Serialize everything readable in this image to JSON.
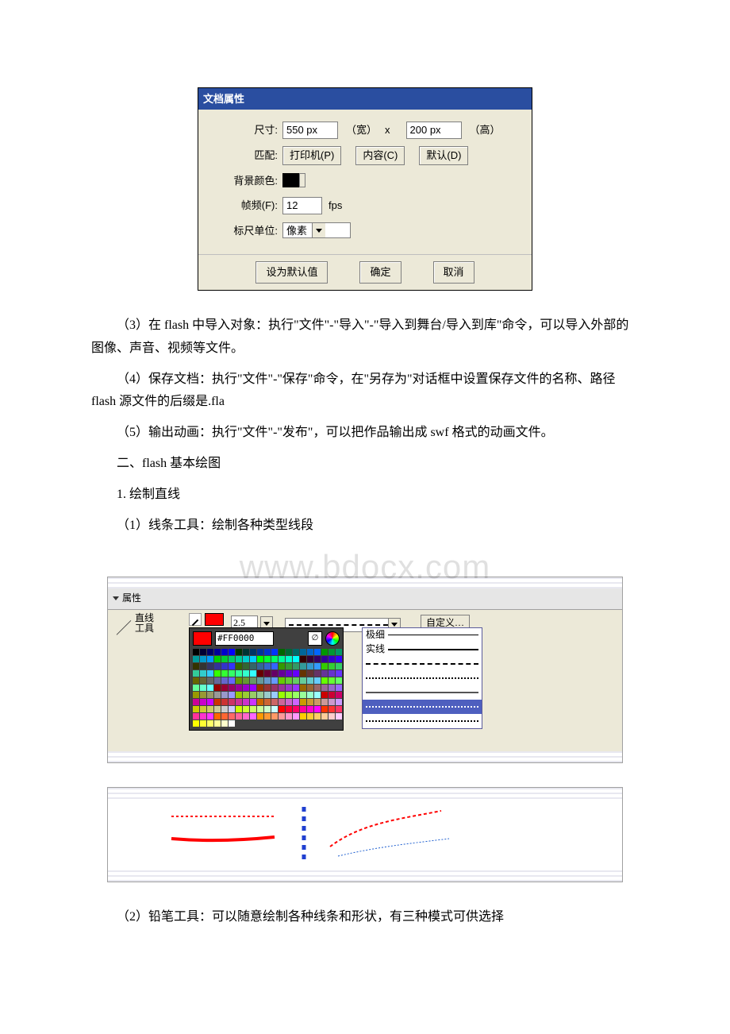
{
  "dialog": {
    "title": "文档属性",
    "size_label": "尺寸:",
    "width_value": "550 px",
    "width_tag": "（宽）",
    "x_sep": "x",
    "height_value": "200 px",
    "height_tag": "（高）",
    "match_label": "匹配:",
    "btn_printer": "打印机(P)",
    "btn_content": "内容(C)",
    "btn_default": "默认(D)",
    "bg_label": "背景颜色:",
    "fps_label": "帧频(F):",
    "fps_value": "12",
    "fps_unit": "fps",
    "ruler_label": "标尺单位:",
    "ruler_value": "像素",
    "btn_set_default": "设为默认值",
    "btn_ok": "确定",
    "btn_cancel": "取消"
  },
  "text": {
    "p3": "（3）在 flash 中导入对象：执行\"文件\"-\"导入\"-\"导入到舞台/导入到库\"命令，可以导入外部的图像、声音、视频等文件。",
    "p4": "（4）保存文档：执行\"文件\"-\"保存\"命令，在\"另存为\"对话框中设置保存文件的名称、路径 flash 源文件的后缀是.fla",
    "p5": "（5）输出动画：执行\"文件\"-\"发布\"，可以把作品输出成 swf 格式的动画文件。",
    "h2": "二、flash 基本绘图",
    "s1": "1. 绘制直线",
    "s1a": "（1）线条工具：绘制各种类型线段",
    "s2": "（2）铅笔工具：可以随意绘制各种线条和形状，有三种模式可供选择"
  },
  "watermark": "www.bdocx.com",
  "panel": {
    "header": "属性",
    "tool_char": "／",
    "tool_label_1": "直线",
    "tool_label_2": "工具",
    "thickness": "2.5",
    "hex": "#FF0000",
    "btn_custom": "自定义…",
    "style_opt_hair": "极细",
    "style_opt_solid": "实线"
  }
}
